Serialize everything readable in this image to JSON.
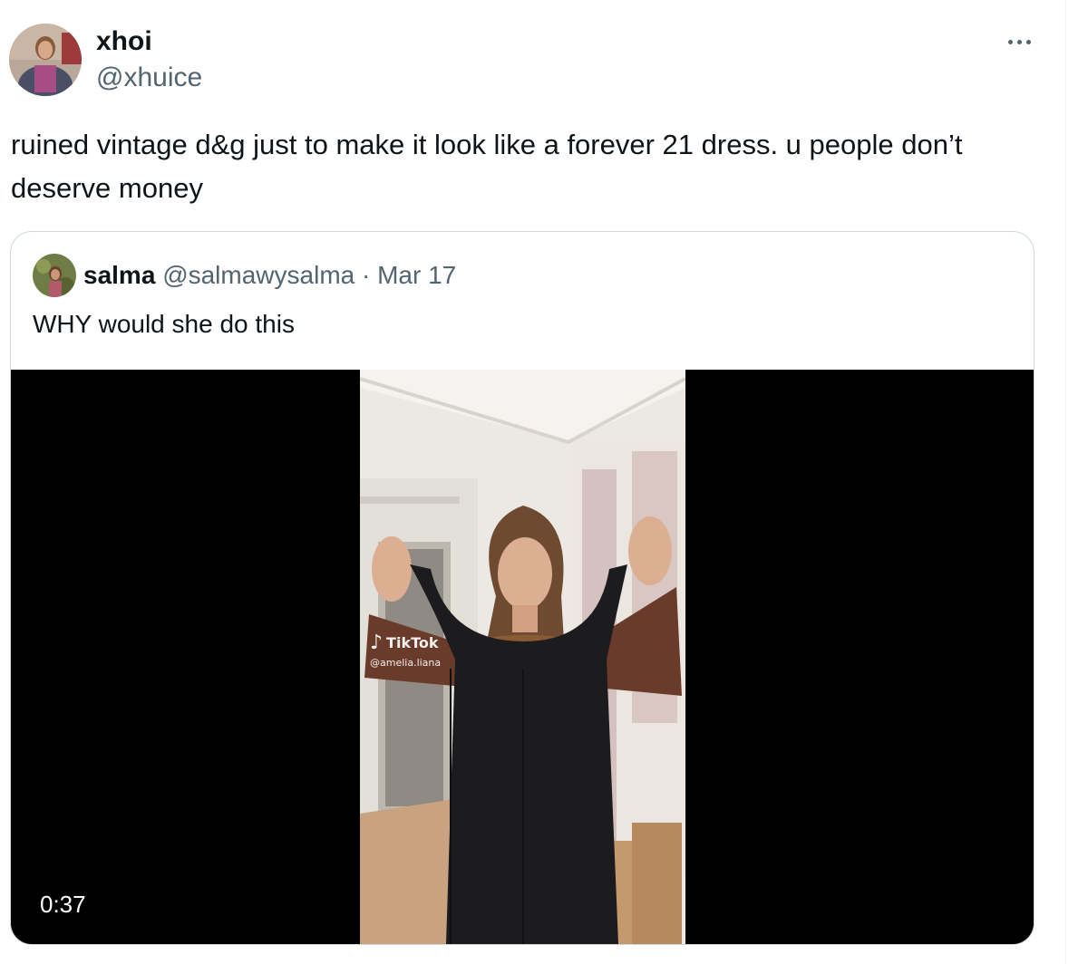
{
  "tweet": {
    "author": {
      "display_name": "xhoi",
      "handle": "@xhuice"
    },
    "text": "ruined vintage d&g just to make it look like a forever 21 dress. u people don’t deserve money",
    "more_icon": "ellipsis-icon"
  },
  "quoted_tweet": {
    "author": {
      "display_name": "salma",
      "handle": "@salmawysalma"
    },
    "separator": "·",
    "date": "Mar 17",
    "text": "WHY would she do this",
    "video": {
      "watermark_brand": "TikTok",
      "watermark_handle": "@amelia.liana",
      "duration": "0:37",
      "watermark_icon": "tiktok-note-icon"
    }
  },
  "colors": {
    "text_primary": "#0f1419",
    "text_secondary": "#536471",
    "card_border": "#cfd9de",
    "video_background": "#000000"
  }
}
